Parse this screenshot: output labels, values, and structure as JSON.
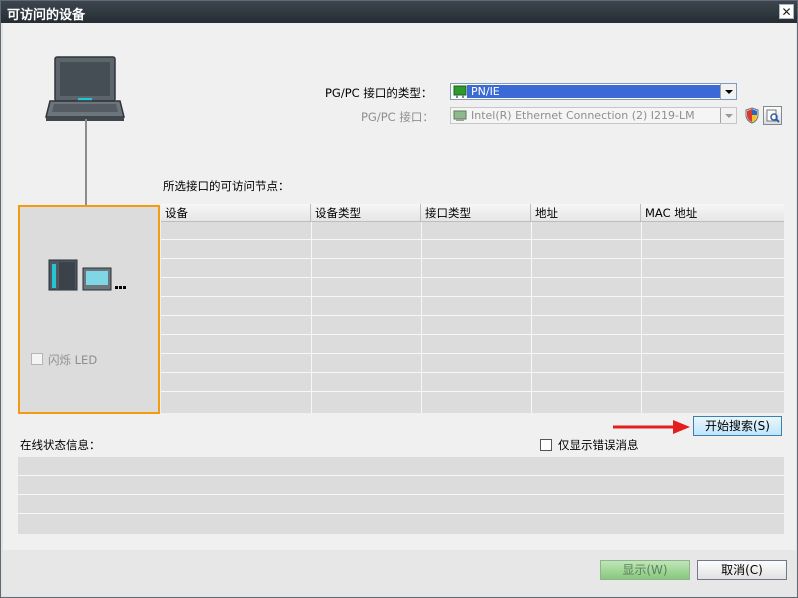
{
  "window": {
    "title": "可访问的设备",
    "close_symbol": "✕"
  },
  "interface": {
    "type_label": "PG/PC 接口的类型：",
    "type_value": "PN/IE",
    "iface_label": "PG/PC 接口：",
    "iface_value": "Intel(R) Ethernet Connection (2) I219-LM"
  },
  "nodes_label": "所选接口的可访问节点：",
  "grid": {
    "columns": [
      "设备",
      "设备类型",
      "接口类型",
      "地址",
      "MAC 地址"
    ],
    "rows": []
  },
  "flash_led_label": "闪烁 LED",
  "search_button": "开始搜索(S)",
  "status_label": "在线状态信息：",
  "show_errors_label": "仅显示错误消息",
  "buttons": {
    "display": "显示(W)",
    "cancel": "取消(C)"
  },
  "colors": {
    "highlight": "#3b6ad6",
    "device_border": "#f39c12",
    "arrow": "#e31e1e"
  }
}
